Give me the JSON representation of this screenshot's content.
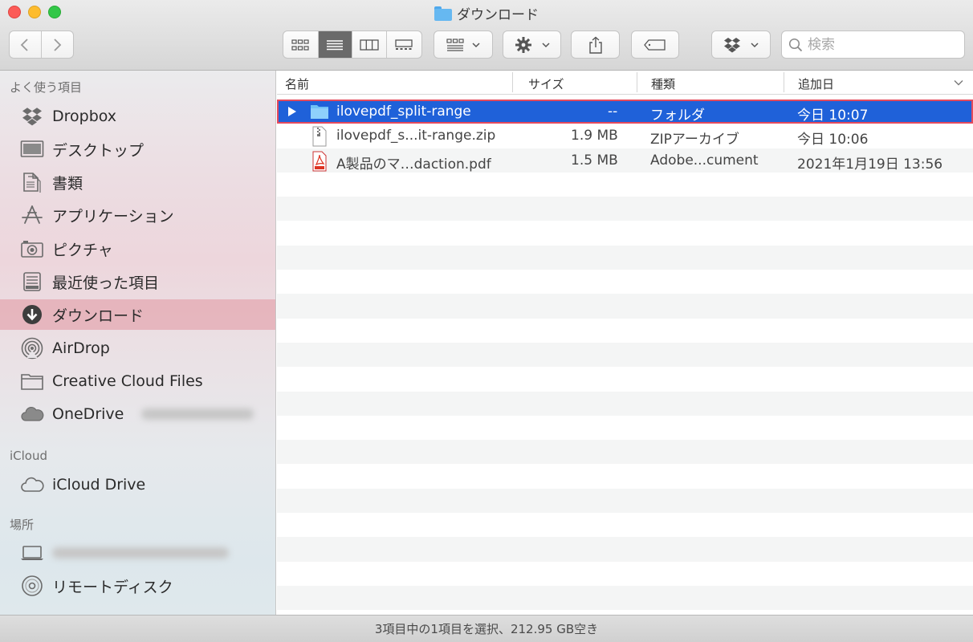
{
  "window": {
    "title": "ダウンロード"
  },
  "toolbar": {
    "search_placeholder": "検索",
    "back_icon": "chevron-left-icon",
    "forward_icon": "chevron-right-icon",
    "view_modes": [
      "icon-view-icon",
      "list-view-icon",
      "column-view-icon",
      "gallery-view-icon"
    ],
    "active_view": "list-view-icon"
  },
  "sidebar": {
    "favorites_header": "よく使う項目",
    "favorites": [
      {
        "label": "Dropbox",
        "icon": "dropbox-icon"
      },
      {
        "label": "デスクトップ",
        "icon": "desktop-icon"
      },
      {
        "label": "書類",
        "icon": "documents-icon"
      },
      {
        "label": "アプリケーション",
        "icon": "applications-icon"
      },
      {
        "label": "ピクチャ",
        "icon": "camera-icon"
      },
      {
        "label": "最近使った項目",
        "icon": "recents-icon"
      },
      {
        "label": "ダウンロード",
        "icon": "download-icon",
        "selected": true
      },
      {
        "label": "AirDrop",
        "icon": "airdrop-icon"
      },
      {
        "label": "Creative Cloud Files",
        "icon": "folder-icon"
      },
      {
        "label": "OneDrive",
        "icon": "cloud-icon"
      }
    ],
    "icloud_header": "iCloud",
    "icloud": [
      {
        "label": "iCloud Drive",
        "icon": "cloud-icon"
      }
    ],
    "locations_header": "場所",
    "locations": [
      {
        "label": "",
        "icon": "laptop-icon"
      },
      {
        "label": "リモートディスク",
        "icon": "disc-icon"
      }
    ]
  },
  "columns": {
    "name": "名前",
    "size": "サイズ",
    "kind": "種類",
    "date_added": "追加日"
  },
  "files": [
    {
      "name": "ilovepdf_split-range",
      "size": "--",
      "kind": "フォルダ",
      "date": "今日 10:07",
      "icon": "folder-icon",
      "selected": true
    },
    {
      "name": "ilovepdf_s...it-range.zip",
      "size": "1.9 MB",
      "kind": "ZIPアーカイブ",
      "date": "今日 10:06",
      "icon": "zip-icon"
    },
    {
      "name": "A製品のマ…daction.pdf",
      "size": "1.5 MB",
      "kind": "Adobe...cument",
      "date": "2021年1月19日 13:56",
      "icon": "pdf-icon"
    }
  ],
  "status": {
    "text": "3項目中の1項目を選択、212.95 GB空き"
  },
  "colors": {
    "selection": "#1f61d9",
    "selection_outline": "#e54a5c",
    "sidebar_selected": "#e296a0"
  }
}
